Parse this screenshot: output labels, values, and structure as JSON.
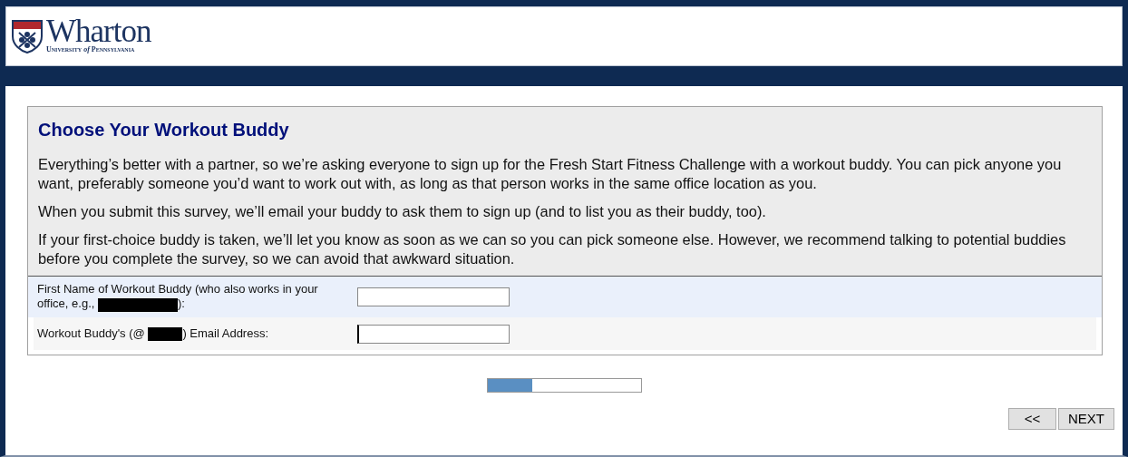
{
  "logo": {
    "name": "Wharton",
    "subtitle_a": "University",
    "subtitle_b": "of",
    "subtitle_c": "Pennsylvania"
  },
  "question": {
    "title": "Choose Your Workout Buddy",
    "paragraphs": [
      "Everything’s better with a partner, so we’re asking everyone to sign up for the Fresh Start Fitness Challenge with a workout buddy. You can pick anyone you want, preferably someone you’d want to work out with, as long as that person works in the same office location as you.",
      "When you submit this survey, we’ll email your buddy to ask them to sign up (and to list you as their buddy, too).",
      "If your first-choice buddy is taken, we’ll let you know as soon as we can so you can pick someone else. However, we recommend talking to potential buddies before you complete the survey, so we can avoid that awkward situation."
    ]
  },
  "fields": [
    {
      "label_before": [
        "First Name of Workout Buddy (who also works in your",
        "office, e.g.,"
      ],
      "redacted": true,
      "label_after": "):",
      "focused": false
    },
    {
      "label_before": [
        "Workout Buddy's (@"
      ],
      "redacted": true,
      "label_after": ") Email Address:",
      "focused": true
    }
  ],
  "progress": {
    "level": 0.29
  },
  "buttons": [
    {
      "label": "<<",
      "kind": "back"
    },
    {
      "label": "NEXT",
      "kind": "next"
    }
  ]
}
